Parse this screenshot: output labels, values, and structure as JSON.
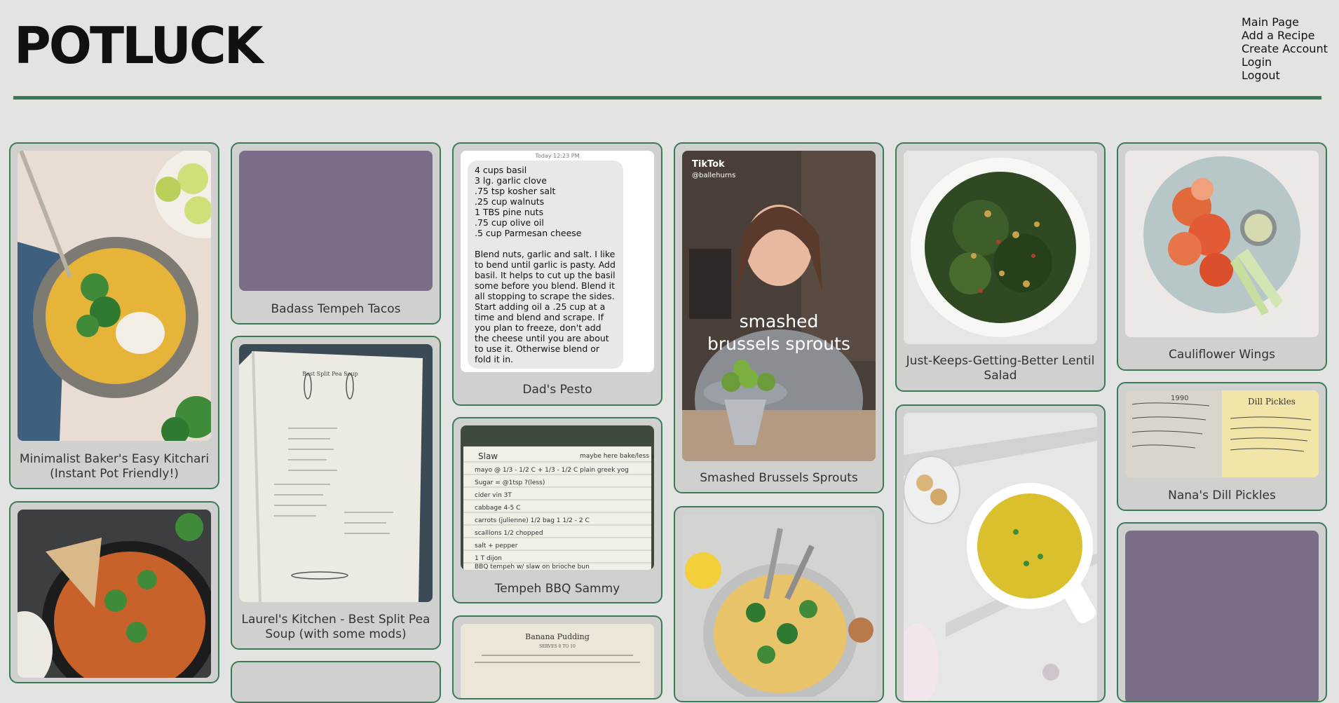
{
  "header": {
    "brand": "POTLUCK"
  },
  "nav": [
    "Main Page",
    "Add a Recipe",
    "Create Account",
    "Login",
    "Logout"
  ],
  "recipes": {
    "kitchari": "Minimalist Baker's Easy Kitchari (Instant Pot Friendly!)",
    "tacos": "Badass Tempeh Tacos",
    "split_pea": "Laurel's Kitchen - Best Split Pea Soup (with some mods)",
    "pesto": "Dad's Pesto",
    "bbq": "Tempeh BBQ Sammy",
    "brussels": "Smashed Brussels Sprouts",
    "lentil": "Just-Keeps-Getting-Better Lentil Salad",
    "cauliflower": "Cauliflower Wings",
    "pickles": "Nana's Dill Pickles"
  },
  "pesto_message": {
    "timestamp": "Today 12:23 PM",
    "lines": [
      "4 cups basil",
      "3 lg. garlic clove",
      ".75 tsp kosher salt",
      ".25 cup walnuts",
      "1 TBS pine nuts",
      ".75 cup olive oil",
      ".5 cup Parmesan cheese",
      "",
      "Blend nuts, garlic and salt. I like to bend until garlic is pasty. Add basil. It helps to cut up the basil some before you blend. Blend it all stopping to scrape the sides. Start adding oil a .25 cup at a time and blend and scrape. If you plan to freeze, don't add the cheese until you are about to use it. Otherwise blend or fold it in."
    ]
  },
  "brussels_video": {
    "app": "TikTok",
    "handle": "@ballehurns",
    "overlay_line1": "smashed",
    "overlay_line2": "brussels sprouts"
  },
  "recipe_card_bbq": {
    "title": "Slaw",
    "note": "maybe here bake/less you",
    "lines": [
      "mayo @ 1/3 - 1/2 C + 1/3 - 1/2 C plain greek yog",
      "Sugar = @1tsp ?(less)",
      "cider vin 3T",
      "cabbage 4-5 C",
      "carrots (julienne) 1/2 bag 1 1/2 - 2 C",
      "scallions 1/2 chopped",
      "salt + pepper",
      "1 T dijon",
      "BBQ tempeh w/ slaw on brioche bun"
    ]
  },
  "pudding_page": {
    "title": "Banana Pudding",
    "serves": "SERVES 8 TO 10"
  },
  "pickles_card": {
    "title": "Dill Pickles",
    "year": "1990"
  },
  "split_pea_page": {
    "title": "Best Split Pea Soup"
  },
  "colors": {
    "background": "#e3e4e1",
    "accent": "#3b7a57",
    "card": "#d0d0ce",
    "placeholder": "#7c6d89"
  }
}
